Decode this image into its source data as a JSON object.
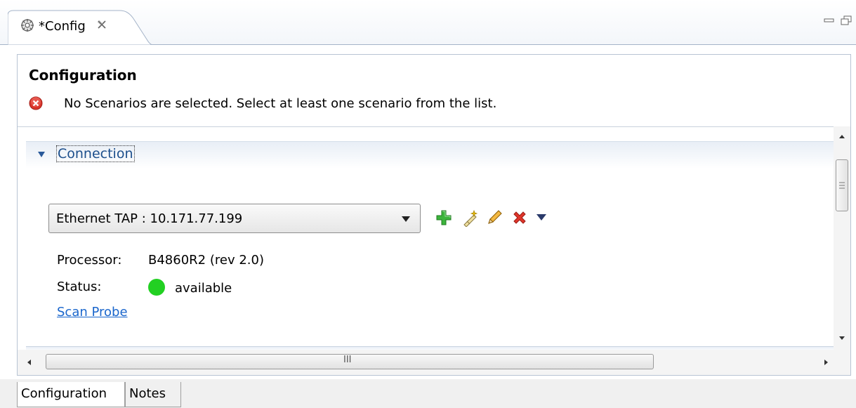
{
  "window": {
    "tab_title": "*Config",
    "tab_icon": "gear-icon",
    "close_icon": "close-icon",
    "minimize_icon": "minimize-icon",
    "maximize_icon": "maximize-icon"
  },
  "header": {
    "title": "Configuration",
    "error_icon": "error-icon",
    "error_message": "No Scenarios are selected. Select at least one scenario from the list."
  },
  "connection": {
    "section_title": "Connection",
    "expanded": true,
    "selected_connection": "Ethernet TAP : 10.171.77.199",
    "toolbar_icons": [
      "add-icon",
      "wand-icon",
      "pencil-icon",
      "delete-icon",
      "dropdown-icon"
    ],
    "processor_label": "Processor:",
    "processor_value": "B4860R2 (rev 2.0)",
    "status_label": "Status:",
    "status_value": "available",
    "status_color": "#22d022",
    "scan_link": "Scan Probe"
  },
  "scrollbars": {
    "horizontal_thumb_grip": "III"
  },
  "bottom_tabs": [
    {
      "label": "Configuration",
      "active": true
    },
    {
      "label": "Notes",
      "active": false
    }
  ],
  "colors": {
    "section_title": "#1c4f8c",
    "link": "#1a66cc",
    "error": "#d9342b",
    "add": "#2ea82e"
  }
}
